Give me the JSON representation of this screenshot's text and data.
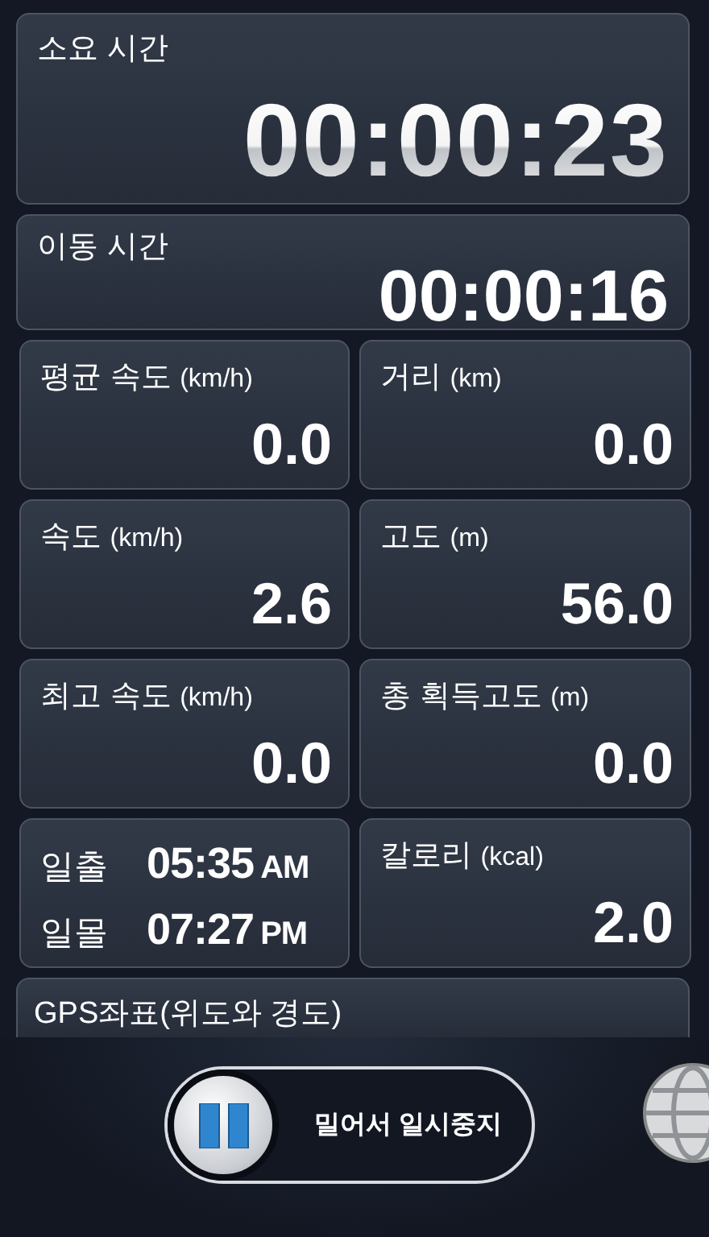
{
  "total_time": {
    "label": "소요 시간",
    "value": "00:00:23"
  },
  "moving_time": {
    "label": "이동 시간",
    "value": "00:00:16"
  },
  "stats": [
    {
      "kind": "stat",
      "label": "평균 속도",
      "unit": "(km/h)",
      "value": "0.0"
    },
    {
      "kind": "stat",
      "label": "거리",
      "unit": "(km)",
      "value": "0.0"
    },
    {
      "kind": "stat",
      "label": "속도",
      "unit": "(km/h)",
      "value": "2.6"
    },
    {
      "kind": "stat",
      "label": "고도",
      "unit": "(m)",
      "value": "56.0"
    },
    {
      "kind": "stat",
      "label": "최고 속도",
      "unit": "(km/h)",
      "value": "0.0"
    },
    {
      "kind": "stat",
      "label": "총 획득고도",
      "unit": "(m)",
      "value": "0.0"
    },
    {
      "kind": "sun",
      "rows": [
        {
          "label": "일출",
          "time": "05:35",
          "suffix": "AM"
        },
        {
          "label": "일몰",
          "time": "07:27",
          "suffix": "PM"
        }
      ]
    },
    {
      "kind": "stat",
      "label": "칼로리",
      "unit": "(kcal)",
      "value": "2.0"
    }
  ],
  "gps": {
    "label": "GPS좌표(위도와 경도)"
  },
  "pause_control": {
    "label": "밀어서 일시중지",
    "level": 0
  }
}
